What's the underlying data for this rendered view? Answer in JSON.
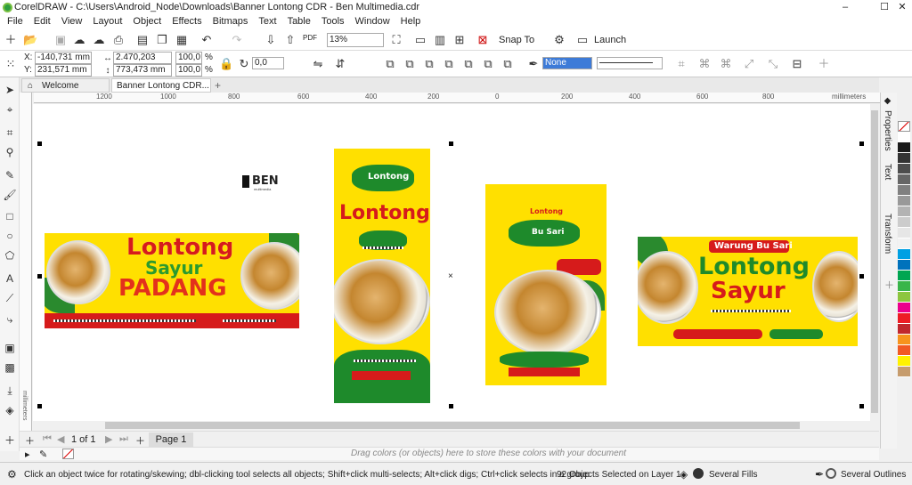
{
  "window": {
    "title": "CorelDRAW - C:\\Users\\Android_Node\\Downloads\\Banner Lontong CDR - Ben Multimedia.cdr",
    "minimize": "–",
    "maximize": "☐",
    "close": "✕"
  },
  "menu": [
    "File",
    "Edit",
    "View",
    "Layout",
    "Object",
    "Effects",
    "Bitmaps",
    "Text",
    "Table",
    "Tools",
    "Window",
    "Help"
  ],
  "toolbar": {
    "zoom": "13%",
    "snap_to": "Snap To",
    "launch": "Launch",
    "pdf_label": "PDF"
  },
  "propbar": {
    "x_label": "X:",
    "x_value": "-140,731 mm",
    "y_label": "Y:",
    "y_value": "231,571 mm",
    "w_value": "2.470,203 mm",
    "h_value": "773,473 mm",
    "scale_w": "100,0",
    "scale_h": "100,0",
    "pct": "%",
    "rotation": "0,0",
    "outline_fill": "None"
  },
  "tabs": {
    "welcome": "Welcome Screen",
    "document": "Banner Lontong CDR...",
    "add": "+"
  },
  "ruler": {
    "units": "millimeters",
    "ticks": [
      "1200",
      "1000",
      "800",
      "600",
      "400",
      "200",
      "0",
      "200",
      "400",
      "600",
      "800"
    ]
  },
  "vruler_units": "millimeters",
  "pagebar": {
    "page_of": "1 of 1",
    "page_tab": "Page 1"
  },
  "colorbar_hint": "Drag colors (or objects) here to store these colors with your document",
  "status": {
    "hint": "Click an object twice for rotating/skewing; dbl-clicking tool selects all objects; Shift+click multi-selects; Alt+click digs; Ctrl+click selects in a group",
    "selection": "92 Objects Selected on Layer 1",
    "fills": "Several Fills",
    "outlines": "Several Outlines"
  },
  "dockers": [
    "Properties",
    "Text",
    "Transform"
  ],
  "palette_colors": [
    "#ffffff",
    "#1a1a1a",
    "#333333",
    "#4d4d4d",
    "#666666",
    "#808080",
    "#999999",
    "#b3b3b3",
    "#cccccc",
    "#e6e6e6",
    "#f2f2f2",
    "#00a0e3",
    "#0072bc",
    "#00a651",
    "#39b54a",
    "#8dc63f",
    "#ec008c",
    "#ed1c24",
    "#c1272d",
    "#f7941d",
    "#f15a24",
    "#fff200",
    "#c69c6d"
  ],
  "logo": {
    "text": "BEN",
    "sub": "multimedia"
  },
  "banners": {
    "b1": {
      "line1": "Lontong",
      "line2": "Sayur",
      "line3": "PADANG"
    },
    "b2": {
      "badge": "Lontong",
      "title": "Lontong"
    },
    "b3": {
      "title1": "Lontong",
      "title2": "Bu Sari"
    },
    "b4": {
      "top": "Warung Bu Sari",
      "line1": "Lontong",
      "line2": "Sayur"
    }
  }
}
